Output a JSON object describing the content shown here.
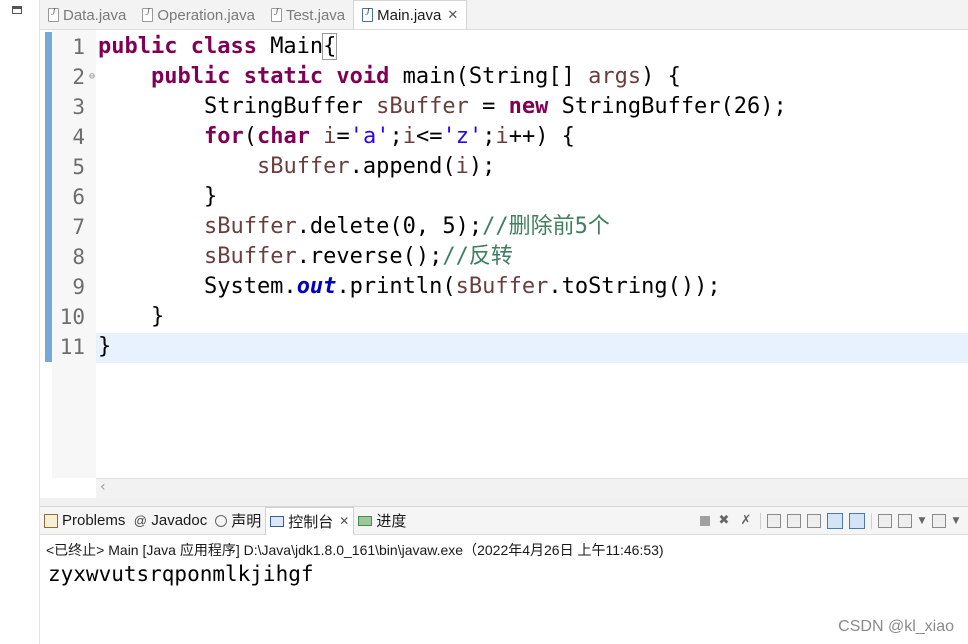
{
  "editor_tabs": [
    {
      "label": "Data.java"
    },
    {
      "label": "Operation.java"
    },
    {
      "label": "Test.java"
    },
    {
      "label": "Main.java",
      "active": true
    }
  ],
  "editor": {
    "lines": [
      {
        "num": "1",
        "segments": [
          {
            "t": "public class ",
            "c": "kw"
          },
          {
            "t": "Main",
            "c": ""
          },
          {
            "t": "{",
            "c": "brk"
          }
        ]
      },
      {
        "num": "2",
        "fold": true,
        "segments": [
          {
            "t": "    ",
            "c": ""
          },
          {
            "t": "public static void ",
            "c": "kw"
          },
          {
            "t": "main(String[] ",
            "c": ""
          },
          {
            "t": "args",
            "c": "var"
          },
          {
            "t": ") {",
            "c": ""
          }
        ]
      },
      {
        "num": "3",
        "segments": [
          {
            "t": "        StringBuffer ",
            "c": ""
          },
          {
            "t": "sBuffer",
            "c": "var"
          },
          {
            "t": " = ",
            "c": ""
          },
          {
            "t": "new ",
            "c": "kw"
          },
          {
            "t": "StringBuffer(26);",
            "c": ""
          }
        ]
      },
      {
        "num": "4",
        "segments": [
          {
            "t": "        ",
            "c": ""
          },
          {
            "t": "for",
            "c": "kw"
          },
          {
            "t": "(",
            "c": ""
          },
          {
            "t": "char ",
            "c": "kw"
          },
          {
            "t": "i",
            "c": "var"
          },
          {
            "t": "=",
            "c": ""
          },
          {
            "t": "'a'",
            "c": "str"
          },
          {
            "t": ";",
            "c": ""
          },
          {
            "t": "i",
            "c": "var"
          },
          {
            "t": "<=",
            "c": ""
          },
          {
            "t": "'z'",
            "c": "str"
          },
          {
            "t": ";",
            "c": ""
          },
          {
            "t": "i",
            "c": "var"
          },
          {
            "t": "++) {",
            "c": ""
          }
        ]
      },
      {
        "num": "5",
        "segments": [
          {
            "t": "            ",
            "c": ""
          },
          {
            "t": "sBuffer",
            "c": "var"
          },
          {
            "t": ".append(",
            "c": ""
          },
          {
            "t": "i",
            "c": "var"
          },
          {
            "t": ");",
            "c": ""
          }
        ]
      },
      {
        "num": "6",
        "segments": [
          {
            "t": "        }",
            "c": ""
          }
        ]
      },
      {
        "num": "7",
        "segments": [
          {
            "t": "        ",
            "c": ""
          },
          {
            "t": "sBuffer",
            "c": "var"
          },
          {
            "t": ".delete(0, 5);",
            "c": ""
          },
          {
            "t": "//删除前5个",
            "c": "cm"
          }
        ]
      },
      {
        "num": "8",
        "segments": [
          {
            "t": "        ",
            "c": ""
          },
          {
            "t": "sBuffer",
            "c": "var"
          },
          {
            "t": ".reverse();",
            "c": ""
          },
          {
            "t": "//反转",
            "c": "cm"
          }
        ]
      },
      {
        "num": "9",
        "segments": [
          {
            "t": "        System.",
            "c": ""
          },
          {
            "t": "out",
            "c": "fld"
          },
          {
            "t": ".println(",
            "c": ""
          },
          {
            "t": "sBuffer",
            "c": "var"
          },
          {
            "t": ".toString());",
            "c": ""
          }
        ]
      },
      {
        "num": "10",
        "segments": [
          {
            "t": "    }",
            "c": ""
          }
        ]
      },
      {
        "num": "11",
        "segments": [
          {
            "t": "}",
            "c": ""
          }
        ]
      }
    ]
  },
  "console_tabs": [
    {
      "label": "Problems",
      "icon": "problems-icon"
    },
    {
      "label": "Javadoc",
      "icon": "at-icon"
    },
    {
      "label": "声明",
      "icon": "declaration-icon"
    },
    {
      "label": "控制台",
      "icon": "console-icon",
      "active": true
    },
    {
      "label": "进度",
      "icon": "progress-icon"
    }
  ],
  "console": {
    "status_line": "<已终止> Main [Java 应用程序] D:\\Java\\jdk1.8.0_161\\bin\\javaw.exe（2022年4月26日 上午11:46:53)",
    "output": "zyxwvutsrqponmlkjihgf"
  },
  "watermark": "CSDN @kl_xiao"
}
